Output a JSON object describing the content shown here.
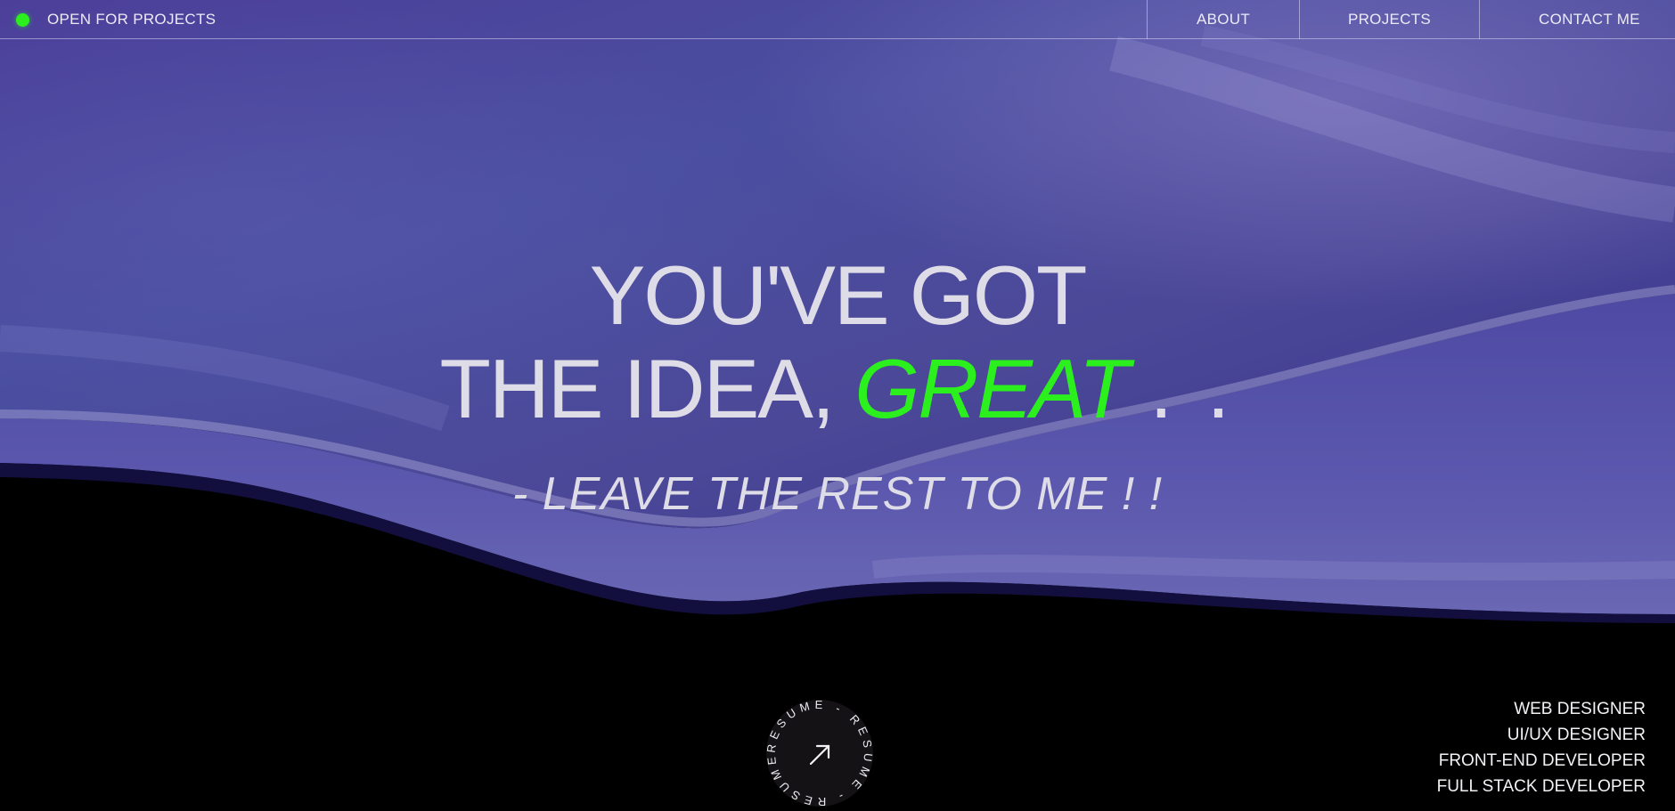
{
  "header": {
    "status_label": "OPEN FOR PROJECTS",
    "nav": {
      "about": "ABOUT",
      "projects": "PROJECTS",
      "contact": "CONTACT ME"
    }
  },
  "hero": {
    "line1": "YOU'VE GOT",
    "line2_start": "THE IDEA,",
    "line2_highlight": "GREAT",
    "line2_end": ". .",
    "tagline": "- LEAVE THE REST TO ME ! !"
  },
  "resume_badge": {
    "ring_text": "RESUME - RESUME - RESUME - ",
    "icon": "arrow-up-right-icon"
  },
  "roles": [
    "WEB DESIGNER",
    "UI/UX DESIGNER",
    "FRONT-END DEVELOPER",
    "FULL STACK DEVELOPER"
  ],
  "colors": {
    "accent": "#2cf01e",
    "background": "#000000",
    "wave": "#4a44a0",
    "text": "#dedce6"
  }
}
